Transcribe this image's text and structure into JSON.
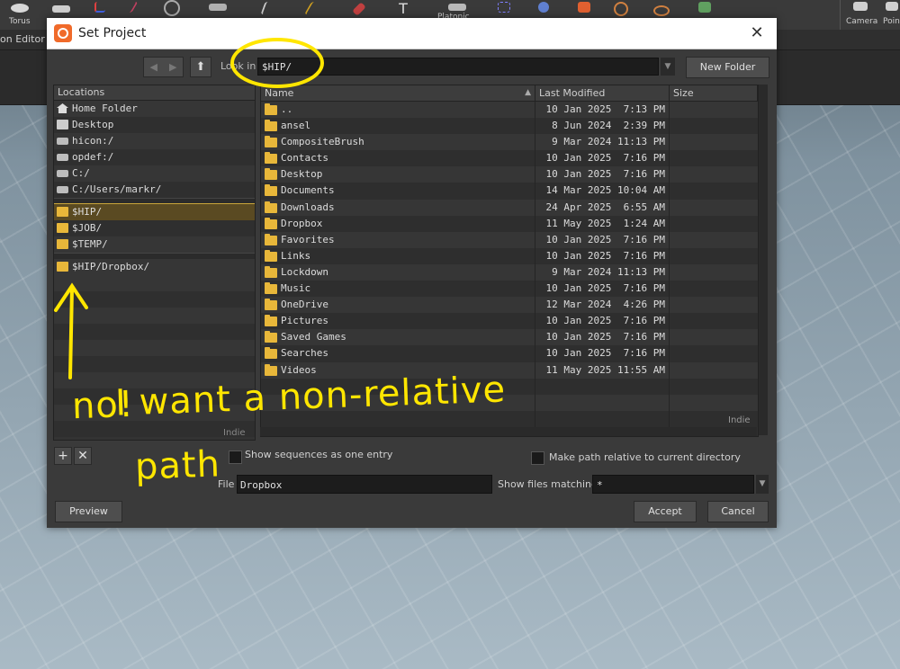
{
  "background": {
    "shelf": {
      "torus": "Torus",
      "platonic": "Platonic",
      "camera": "Camera",
      "point": "Poin"
    },
    "editor_tab": "on Editor"
  },
  "dialog": {
    "title": "Set Project",
    "close_glyph": "✕",
    "nav": {
      "back": "◀",
      "forward": "▶",
      "up": "⬆"
    },
    "look_in_label": "Look in",
    "look_in_value": "$HIP/",
    "dropdown_glyph": "▼",
    "new_folder_label": "New Folder",
    "locations": {
      "header": "Locations",
      "system": [
        {
          "label": "Home Folder",
          "icon": "home-icon"
        },
        {
          "label": "Desktop",
          "icon": "desktop-icon"
        },
        {
          "label": "hicon:/",
          "icon": "drive-icon"
        },
        {
          "label": "opdef:/",
          "icon": "drive-icon"
        },
        {
          "label": "C:/",
          "icon": "drive-icon"
        },
        {
          "label": "C:/Users/markr/",
          "icon": "drive-icon"
        }
      ],
      "vars": [
        {
          "label": "$HIP/",
          "selected": true
        },
        {
          "label": "$JOB/",
          "selected": false
        },
        {
          "label": "$TEMP/",
          "selected": false
        }
      ],
      "favorites": [
        {
          "label": "$HIP/Dropbox/"
        }
      ],
      "watermark": "Indie",
      "add_glyph": "+",
      "remove_glyph": "✕"
    },
    "files": {
      "columns": {
        "name": "Name",
        "modified": "Last Modified",
        "size": "Size"
      },
      "sort_glyph": "▲",
      "rows": [
        {
          "name": "..",
          "modified": "10 Jan 2025  7:13 PM"
        },
        {
          "name": "ansel",
          "modified": "8 Jun 2024  2:39 PM"
        },
        {
          "name": "CompositeBrush",
          "modified": "9 Mar 2024 11:13 PM"
        },
        {
          "name": "Contacts",
          "modified": "10 Jan 2025  7:16 PM"
        },
        {
          "name": "Desktop",
          "modified": "10 Jan 2025  7:16 PM"
        },
        {
          "name": "Documents",
          "modified": "14 Mar 2025 10:04 AM"
        },
        {
          "name": "Downloads",
          "modified": "24 Apr 2025  6:55 AM"
        },
        {
          "name": "Dropbox",
          "modified": "11 May 2025  1:24 AM"
        },
        {
          "name": "Favorites",
          "modified": "10 Jan 2025  7:16 PM"
        },
        {
          "name": "Links",
          "modified": "10 Jan 2025  7:16 PM"
        },
        {
          "name": "Lockdown",
          "modified": "9 Mar 2024 11:13 PM"
        },
        {
          "name": "Music",
          "modified": "10 Jan 2025  7:16 PM"
        },
        {
          "name": "OneDrive",
          "modified": "12 Mar 2024  4:26 PM"
        },
        {
          "name": "Pictures",
          "modified": "10 Jan 2025  7:16 PM"
        },
        {
          "name": "Saved Games",
          "modified": "10 Jan 2025  7:16 PM"
        },
        {
          "name": "Searches",
          "modified": "10 Jan 2025  7:16 PM"
        },
        {
          "name": "Videos",
          "modified": "11 May 2025 11:55 AM"
        }
      ],
      "watermark": "Indie"
    },
    "show_sequences_label": "Show sequences as one entry",
    "make_relative_label": "Make path relative to current directory",
    "file_label": "File",
    "file_value": "Dropbox",
    "show_matching_label": "Show files matching",
    "show_matching_value": "*",
    "buttons": {
      "preview": "Preview",
      "accept": "Accept",
      "cancel": "Cancel"
    }
  },
  "annotation": {
    "text_line1": "no!",
    "text_line2": "I want a non-relative",
    "text_line3": "path",
    "color": "#ffe600"
  }
}
